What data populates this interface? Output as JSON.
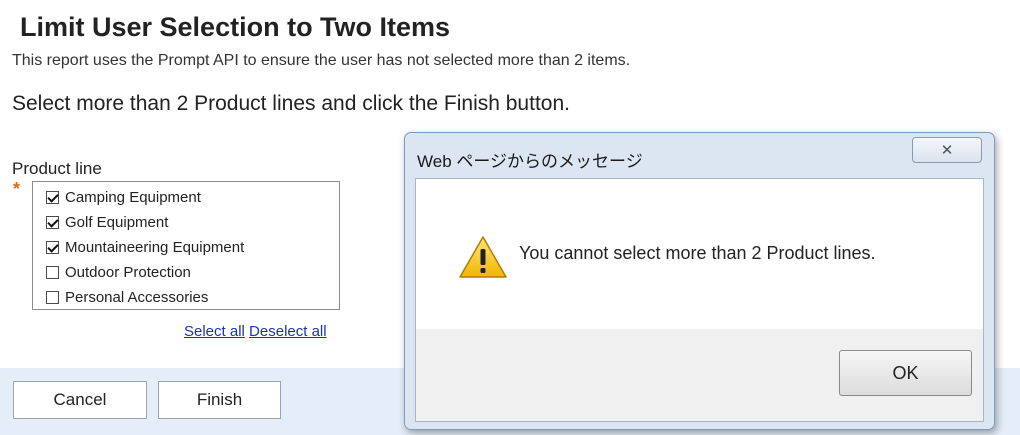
{
  "page": {
    "title": "Limit User Selection to Two Items",
    "description": "This report uses the Prompt API to ensure the user has not selected more than 2 items.",
    "instruction": "Select more than 2 Product lines and click the Finish button."
  },
  "prompt": {
    "label": "Product line",
    "required_marker": "*",
    "options": [
      {
        "label": "Camping Equipment",
        "checked": true
      },
      {
        "label": "Golf Equipment",
        "checked": true
      },
      {
        "label": "Mountaineering Equipment",
        "checked": true
      },
      {
        "label": "Outdoor Protection",
        "checked": false
      },
      {
        "label": "Personal Accessories",
        "checked": false
      }
    ],
    "select_all": "Select all",
    "deselect_all": "Deselect all"
  },
  "footer": {
    "cancel_label": "Cancel",
    "finish_label": "Finish"
  },
  "dialog": {
    "title": "Web ページからのメッセージ",
    "close_label": "✕",
    "message": "You cannot select more than 2 Product lines.",
    "ok_label": "OK",
    "icon": "warning-icon"
  },
  "colors": {
    "required": "#e06a1a",
    "link": "#1a35a8",
    "footer_bg": "#e4edf8",
    "dialog_frame": "#dbe6f2"
  }
}
